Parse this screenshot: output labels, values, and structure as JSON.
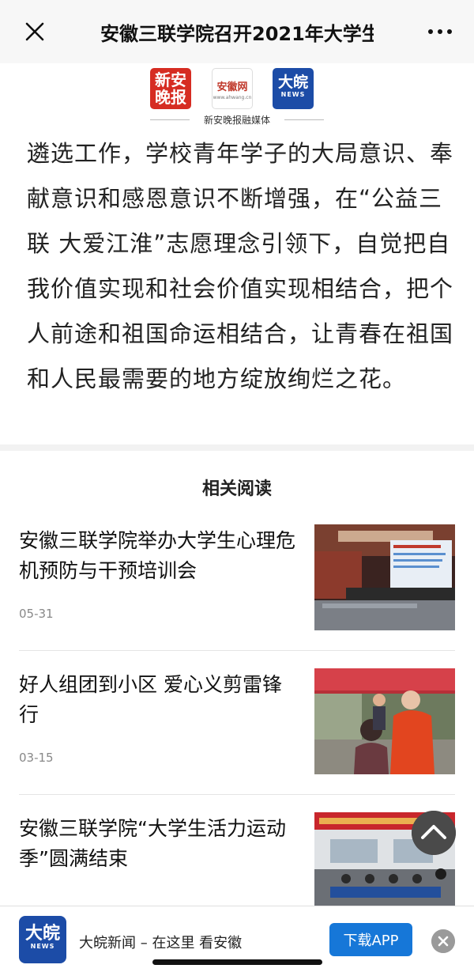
{
  "header": {
    "title": "安徽三联学院召开2021年大学生"
  },
  "logos": {
    "logo1_text": "新安晚报",
    "logo2_text": "安徽网",
    "logo2_url": "www.ahwang.cn",
    "logo3_text": "大皖",
    "logo3_sub": "NEWS",
    "caption": "新安晚报融媒体"
  },
  "article": {
    "text": "遴选工作，学校青年学子的大局意识、奉献意识和感恩意识不断增强，在“公益三联 大爱江淮”志愿理念引领下，自觉把自我价值实现和社会价值实现相结合，把个人前途和祖国命运相结合，让青春在祖国和人民最需要的地方绽放绚烂之花。"
  },
  "related": {
    "title": "相关阅读",
    "items": [
      {
        "headline": "安徽三联学院举办大学生心理危机预防与干预培训会",
        "date": "05-31"
      },
      {
        "headline": "好人组团到小区 爱心义剪雷锋行",
        "date": "03-15"
      },
      {
        "headline": "安徽三联学院“大学生活力运动季”圆满结束",
        "date": ""
      }
    ]
  },
  "bottom_bar": {
    "app_icon_text": "大皖",
    "app_icon_sub": "NEWS",
    "slogan": "大皖新闻 – 在这里 看安徽",
    "download_label": "下载APP"
  },
  "icons": {
    "close": "close-icon",
    "more": "more-icon",
    "scroll_top": "chevron-up-icon",
    "dismiss": "dismiss-icon"
  },
  "colors": {
    "brand_blue": "#1c4ca7",
    "button_blue": "#1677d8",
    "brand_red": "#d62c22"
  }
}
